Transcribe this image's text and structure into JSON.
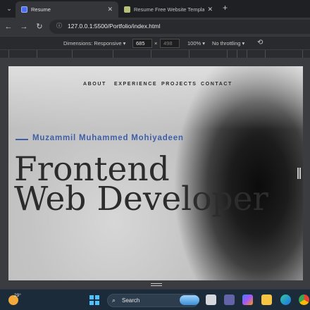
{
  "browser": {
    "tabs": [
      {
        "title": "Resume",
        "active": true,
        "favicon_color": "#4c6ef5"
      },
      {
        "title": "Resume Free Website Template",
        "active": false,
        "favicon_color": "#b8c07a"
      }
    ],
    "url": "127.0.0.1:5500/Portfolio/index.html"
  },
  "devtools": {
    "dimensions_label": "Dimensions: Responsive",
    "width_value": "685",
    "height_value": "498",
    "times": "×",
    "zoom": "100%",
    "throttling": "No throttling"
  },
  "page": {
    "nav": [
      "ABOUT",
      "EXPERIENCE",
      "PROJECTS",
      "CONTACT"
    ],
    "name": "Muzammil Muhammed Mohiyadeen",
    "title_line1": "Frontend",
    "title_line2": "Web Developer"
  },
  "taskbar": {
    "temperature": "29°",
    "search_label": "Search"
  },
  "colors": {
    "accent": "#3f5ea8",
    "browser_chrome": "#35363a",
    "taskbar": "#1c2b3a"
  }
}
